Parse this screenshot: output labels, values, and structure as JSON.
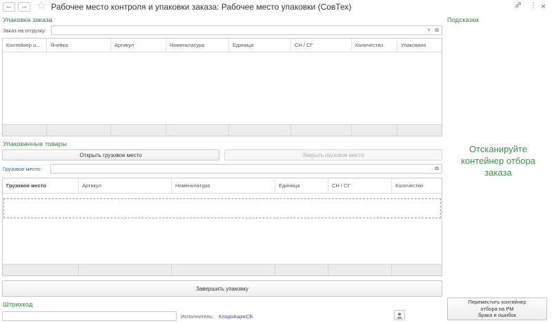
{
  "window": {
    "title": "Рабочее место контроля и упаковки заказа: Рабочее место упаковки (СовТех)",
    "back_icon": "←",
    "forward_icon": "→",
    "favorite_icon": "☆",
    "link_icon": "🔗",
    "menu_icon": "⋮",
    "close_icon": "×"
  },
  "order_packing": {
    "header": "Упаковка заказа",
    "order_label": "Заказ на отгрузку:",
    "order_value": "",
    "clear_icon": "×",
    "open_icon": "⧉",
    "columns": [
      "Контейнер о...",
      "Ячейка",
      "Артикул",
      "Номенклатура",
      "Единица",
      "СН / СГ",
      "Количество",
      "Упаковано"
    ]
  },
  "packed_goods": {
    "header": "Упакованные товары",
    "open_button": "Открыть грузовое место",
    "close_button": "Закрыть грузовое место",
    "cargo_label": "Грузовое место:",
    "cargo_value": "",
    "cargo_open_icon": "⧉",
    "columns": [
      "Грузовое место",
      "Артикул",
      "Номенклатура",
      "Единица",
      "СН / СГ",
      "Количество"
    ],
    "finish_button": "Завершить упаковку"
  },
  "barcode": {
    "header": "Штрихкод",
    "value": "",
    "executor_label": "Исполнитель:",
    "executor_value": "КладовщикСБ"
  },
  "hints": {
    "header": "Подсказки",
    "message": "Отсканируйте контейнер отбора заказа",
    "move_button": [
      "Переместить контейнер",
      "отбора на РМ",
      "брака и ошибок"
    ]
  },
  "colors": {
    "accent_green": "#2e8a3c",
    "link_blue": "#3d5a9c"
  }
}
